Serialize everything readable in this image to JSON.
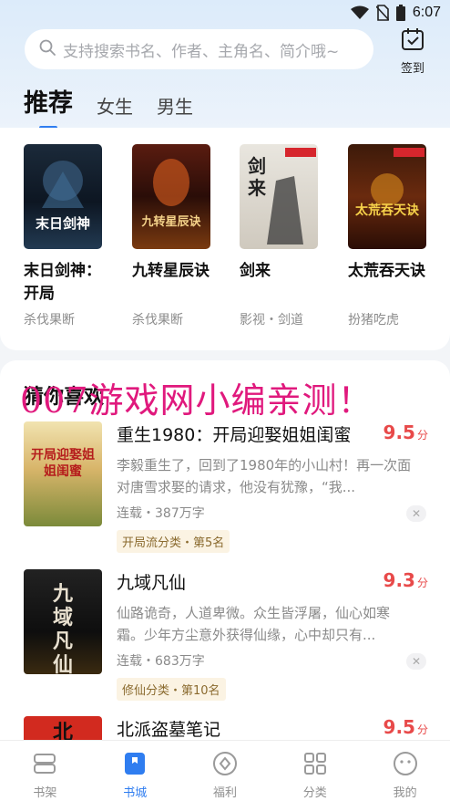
{
  "status_bar": {
    "time": "6:07"
  },
  "search": {
    "placeholder": "支持搜索书名、作者、主角名、简介哦~"
  },
  "checkin": {
    "label": "签到"
  },
  "tabs": [
    {
      "label": "推荐",
      "active": true
    },
    {
      "label": "女生",
      "active": false
    },
    {
      "label": "男生",
      "active": false
    }
  ],
  "recommend": [
    {
      "title": "末日剑神：开局",
      "author": "杀伐果断",
      "cover_text": "末日剑神"
    },
    {
      "title": "九转星辰诀",
      "author": "杀伐果断",
      "cover_text": "九转星辰诀"
    },
    {
      "title": "剑来",
      "author": "影视・剑道",
      "cover_text": "剑来"
    },
    {
      "title": "太荒吞天诀",
      "author": "扮猪吃虎",
      "cover_text": "太荒吞天诀"
    }
  ],
  "guess": {
    "title": "猜你喜欢",
    "watermark": "007游戏网小编亲测！",
    "books": [
      {
        "title": "重生1980：开局迎娶姐姐闺蜜",
        "score": "9.5",
        "unit": "分",
        "desc": "李毅重生了，回到了1980年的小山村！再一次面对唐雪求娶的请求，他没有犹豫，“我...",
        "meta": "连载・387万字",
        "tag": "开局流分类・第5名",
        "cover_text": "开局迎娶姐姐闺蜜"
      },
      {
        "title": "九域凡仙",
        "score": "9.3",
        "unit": "分",
        "desc": "仙路诡奇，人道卑微。众生皆浮屠，仙心如寒霜。少年方尘意外获得仙缘，心中却只有...",
        "meta": "连载・683万字",
        "tag": "修仙分类・第10名",
        "cover_text": "九域凡仙"
      },
      {
        "title": "北派盗墓笔记",
        "score": "9.5",
        "unit": "分",
        "cover_text": "北"
      }
    ]
  },
  "nav": [
    {
      "label": "书架",
      "icon": "bookshelf-icon"
    },
    {
      "label": "书城",
      "icon": "bookstore-icon",
      "active": true
    },
    {
      "label": "福利",
      "icon": "welfare-icon"
    },
    {
      "label": "分类",
      "icon": "category-icon"
    },
    {
      "label": "我的",
      "icon": "profile-icon"
    }
  ],
  "colors": {
    "accent": "#2f7df0",
    "score": "#e84a4a",
    "watermark": "#e0197d"
  }
}
